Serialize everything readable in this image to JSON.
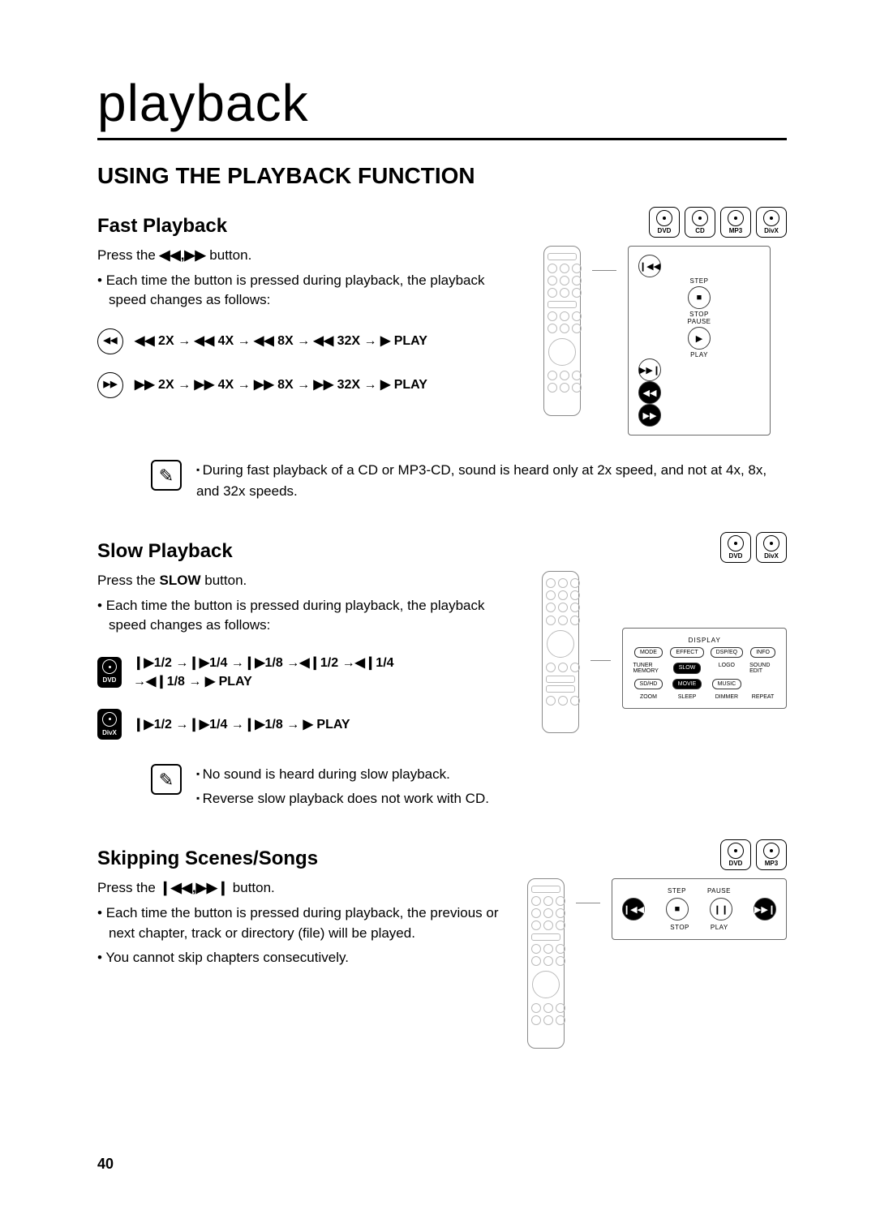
{
  "page_title": "playback",
  "section_title": "USING THE PLAYBACK FUNCTION",
  "page_number": "40",
  "discs": {
    "dvd": "DVD",
    "cd": "CD",
    "mp3": "MP3",
    "divx": "DivX"
  },
  "fast": {
    "title": "Fast Playback",
    "press_pre": "Press the ",
    "press_icons": "◀◀,▶▶",
    "press_post": " button.",
    "bullet1": "Each time the button is pressed during playback, the playback speed changes as follows:",
    "rew_line": "◀◀ 2X → ◀◀ 4X → ◀◀ 8X → ◀◀ 32X → ▶ PLAY",
    "fwd_line": "▶▶ 2X → ▶▶ 4X → ▶▶ 8X → ▶▶ 32X → ▶ PLAY",
    "note": "During fast playback of a CD or MP3-CD, sound is heard only at 2x speed, and not at 4x, 8x, and 32x speeds.",
    "callout": {
      "step": "STEP",
      "pause": "PAUSE",
      "stop": "STOP",
      "play": "PLAY",
      "prev": "❙◀◀",
      "stopb": "■",
      "playb": "▶",
      "next": "▶▶❙",
      "rew": "◀◀",
      "fwd": "▶▶"
    }
  },
  "slow": {
    "title": "Slow Playback",
    "press_pre": "Press the ",
    "press_btn": "SLOW",
    "press_post": " button.",
    "bullet1": "Each time the button is pressed during playback, the playback speed changes as follows:",
    "dvd_line": "❙▶1/2 →❙▶1/4 →❙▶1/8 →◀❙1/2 →◀❙1/4 →◀❙1/8 → ▶ PLAY",
    "divx_line": "❙▶1/2 →❙▶1/4 →❙▶1/8 → ▶ PLAY",
    "note1": "No sound is heard during slow playback.",
    "note2": "Reverse slow playback does not work with CD.",
    "callout": {
      "title": "DISPLAY",
      "mode": "MODE",
      "effect": "EFFECT",
      "dspeq": "DSP/EQ",
      "info": "INFO",
      "tuner": "TUNER MEMORY",
      "slow": "SLOW",
      "logo": "LOGO",
      "soundedit": "SOUND EDIT",
      "sdhd": "SD/HD",
      "movie": "MOVIE",
      "music": "MUSIC",
      "blank": "",
      "zoom": "ZOOM",
      "sleep": "SLEEP",
      "dimmer": "DIMMER",
      "repeat": "REPEAT"
    }
  },
  "skip": {
    "title": "Skipping Scenes/Songs",
    "press_pre": "Press the ",
    "press_icons": "❙◀◀,▶▶❙",
    "press_post": " button.",
    "bullet1": "Each time the button is pressed during playback, the previous or next chapter, track or directory (file) will be played.",
    "bullet2": "You cannot skip chapters consecutively.",
    "callout": {
      "step": "STEP",
      "pause": "PAUSE",
      "stop": "STOP",
      "play": "PLAY",
      "prev": "❙◀◀",
      "pauseb": "❙❙",
      "next": "▶▶❙",
      "stopb": "■",
      "playb": "▶"
    }
  }
}
